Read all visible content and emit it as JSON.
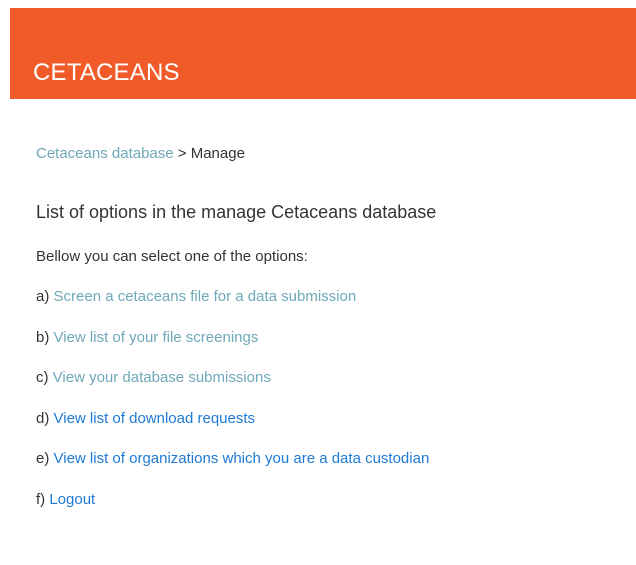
{
  "header": {
    "title": "CETACEANS",
    "background_color": "#f15a29"
  },
  "breadcrumb": {
    "root_label": "Cetaceans database",
    "separator": " > ",
    "current": "Manage"
  },
  "main": {
    "heading": "List of options in the manage Cetaceans database",
    "intro": "Bellow you can select one of the options:",
    "options": [
      {
        "prefix": "a) ",
        "label": "Screen a cetaceans file for a data submission",
        "color": "#6fa8b8"
      },
      {
        "prefix": "b) ",
        "label": "View list of your file screenings",
        "color": "#6fa8b8"
      },
      {
        "prefix": "c) ",
        "label": "View your database submissions",
        "color": "#6fa8b8"
      },
      {
        "prefix": "d) ",
        "label": "View list of download requests",
        "color": "#1e7ad6"
      },
      {
        "prefix": "e) ",
        "label": "View list of organizations which you are a data custodian",
        "color": "#1e7ad6"
      },
      {
        "prefix": "f) ",
        "label": "Logout",
        "color": "#1e7ad6"
      }
    ]
  }
}
